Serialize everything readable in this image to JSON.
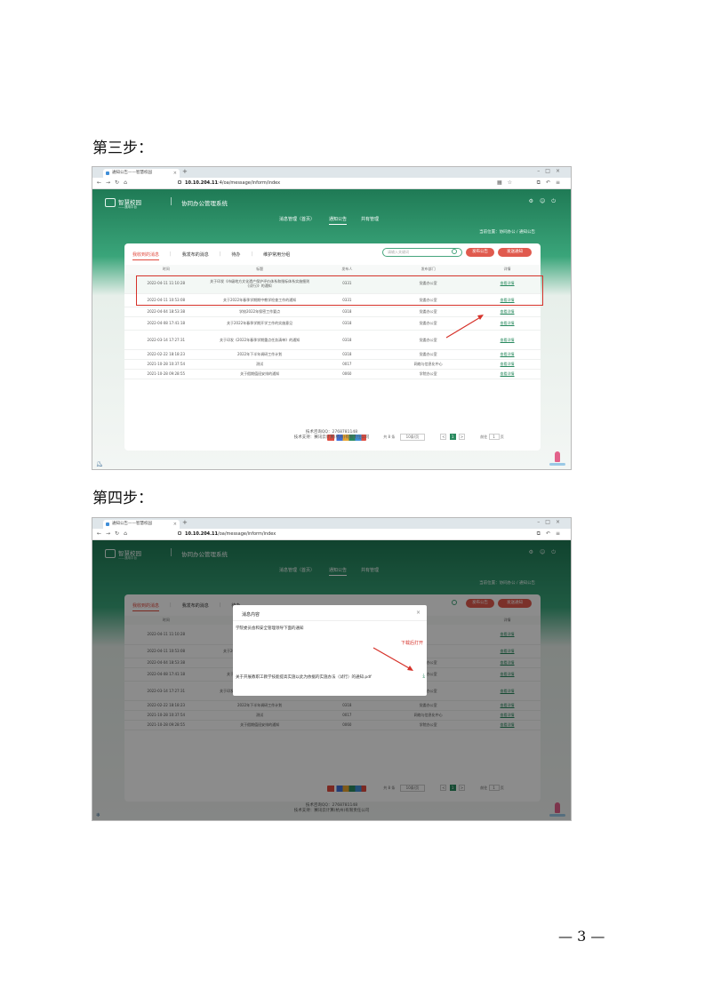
{
  "steps": [
    {
      "title": "第三步：",
      "browser": {
        "tab_title": "通知公告——智慧校园",
        "url_prefix": "10.10.204.11",
        "url_rest": ":4/oa/message/inform/index",
        "new_tab": "+"
      },
      "highlight_row": true,
      "modal": null
    },
    {
      "title": "第四步：",
      "browser": {
        "tab_title": "通知公告——智慧校园",
        "url_prefix": "10.10.204.11",
        "url_rest": "/oa/message/inform/index",
        "new_tab": "+"
      },
      "highlight_row": false,
      "modal": {
        "title": "消息内容",
        "close": "×",
        "body": "学院委员会和安全管理领导下面的通知",
        "file": "关于开展教职工教学技能提高实施以此为依据的实施办法（试行）的通知.pdf",
        "download_note": "下载后打开",
        "download_icon": "⤓"
      }
    }
  ],
  "app": {
    "logo_text": "智慧校园",
    "logo_sub": "——通用平台",
    "system_name": "协同办公管理系统",
    "nav": [
      {
        "label": "消息管理（首页）",
        "active": false
      },
      {
        "label": "通知公告",
        "active": true
      },
      {
        "label": "共有管理",
        "active": false
      }
    ],
    "crumb": "当前位置：协同办公 / 通知公告",
    "subtabs": [
      {
        "label": "我收到的消息",
        "active": true
      },
      {
        "label": "我发布的消息",
        "active": false
      },
      {
        "label": "待办",
        "active": false
      },
      {
        "label": "维护常用分组",
        "active": false
      }
    ],
    "search_placeholder": "请输入关键词",
    "buttons": {
      "publish": "发布公告",
      "draft": "发送通知"
    },
    "table": {
      "headers": [
        "时间",
        "标题",
        "发布人",
        "发布部门",
        "详情"
      ],
      "rows": [
        {
          "time": "2022-04-11 11:10:28",
          "title": "关于印发《市级地方文化遗产保护评价体系和指标体系实施细则(试行)》的通知",
          "author": "0331",
          "dept": "党委办公室",
          "detail": "查看详情"
        },
        {
          "time": "2022-04-11 10:53:08",
          "title": "关于2022年春季学期期中教学检查工作的通知",
          "author": "0331",
          "dept": "党委办公室",
          "detail": "查看详情"
        },
        {
          "time": "2022-04-04 18:53:38",
          "title": "学校2022年保密工作要点",
          "author": "0318",
          "dept": "党委办公室",
          "detail": "查看详情"
        },
        {
          "time": "2022-04-08 17:41:18",
          "title": "关于2022年春季学期开学工作的实施意见",
          "author": "0318",
          "dept": "党委办公室",
          "detail": "查看详情"
        },
        {
          "time": "2022-03-14 17:27:31",
          "title": "关于印发《2022年春季学期重点任务清单》的通知",
          "author": "0318",
          "dept": "党委办公室",
          "detail": "查看详情"
        },
        {
          "time": "2022-02-22 18:18:23",
          "title": "2022年下半年调研工作计划",
          "author": "0318",
          "dept": "党委办公室",
          "detail": "查看详情"
        },
        {
          "time": "2021-10-28 10:37:54",
          "title": "测试",
          "author": "0017",
          "dept": "网络与信息化中心",
          "detail": "查看详情"
        },
        {
          "time": "2021-10-28 09:28:55",
          "title": "关于假期值班安排的通知",
          "author": "0060",
          "dept": "学院办公室",
          "detail": "查看详情"
        }
      ]
    },
    "pager": {
      "total": "共 8 条",
      "per_page": "10条/页",
      "prev": "<",
      "current": "1",
      "next": ">",
      "goto": "前往",
      "goto_value": "1",
      "page_suffix": "页"
    },
    "footer": {
      "line1": "技术咨询QQ：2768781148",
      "line2": "技术支持：赛讯云计算(杭州)有限责任公司"
    }
  },
  "page_number": "— 3 —"
}
